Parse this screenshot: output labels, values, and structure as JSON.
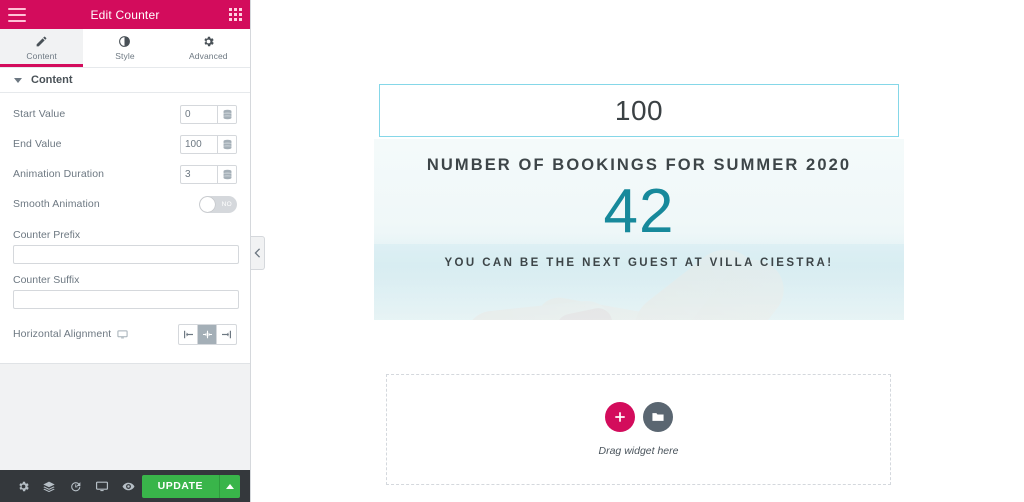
{
  "panel": {
    "header": {
      "title": "Edit Counter",
      "menu_icon": "hamburger-icon",
      "widgets_icon": "grid-icon"
    },
    "tabs": [
      {
        "label": "Content",
        "icon": "pencil-icon",
        "active": true
      },
      {
        "label": "Style",
        "icon": "contrast-icon",
        "active": false
      },
      {
        "label": "Advanced",
        "icon": "gear-icon",
        "active": false
      }
    ],
    "section": {
      "title": "Content",
      "collapse_icon": "caret-down-icon"
    },
    "controls": [
      {
        "label": "Start Value",
        "value": "0",
        "dynamic_icon": "database-icon"
      },
      {
        "label": "End Value",
        "value": "100",
        "dynamic_icon": "database-icon"
      },
      {
        "label": "Animation Duration",
        "value": "3",
        "dynamic_icon": "database-icon"
      }
    ],
    "smooth_animation": {
      "label": "Smooth Animation",
      "state": "NO"
    },
    "counter_prefix": {
      "label": "Counter Prefix",
      "value": "",
      "placeholder": ""
    },
    "counter_suffix": {
      "label": "Counter Suffix",
      "value": "",
      "placeholder": ""
    },
    "horizontal_alignment": {
      "label": "Horizontal Alignment",
      "responsive_icon": "monitor-icon",
      "options": [
        {
          "name": "align-left",
          "active": false
        },
        {
          "name": "align-center",
          "active": true
        },
        {
          "name": "align-right",
          "active": false
        }
      ]
    },
    "footer": {
      "icons": [
        {
          "name": "settings-gear-icon"
        },
        {
          "name": "navigator-layers-icon"
        },
        {
          "name": "history-icon"
        },
        {
          "name": "responsive-mode-icon"
        },
        {
          "name": "preview-eye-icon"
        }
      ],
      "update_label": "UPDATE",
      "update_caret_icon": "caret-up-icon"
    },
    "collapse_handle_icon": "chevron-left-icon"
  },
  "canvas": {
    "counter_widget": {
      "value": "100"
    },
    "hero": {
      "title": "NUMBER OF BOOKINGS FOR SUMMER 2020",
      "count": "42",
      "subtitle": "YOU CAN BE THE NEXT GUEST AT VILLA CIESTRA!"
    },
    "dropzone": {
      "text": "Drag widget here",
      "add_icon": "plus-icon",
      "template_icon": "folder-icon"
    }
  },
  "colors": {
    "brand_pink": "#d30c5c",
    "update_green": "#39b54a",
    "selection_blue": "#85d7e8",
    "counter_teal": "#17899b",
    "panel_bg": "#f1f2f3",
    "footer_dark": "#34383c"
  }
}
